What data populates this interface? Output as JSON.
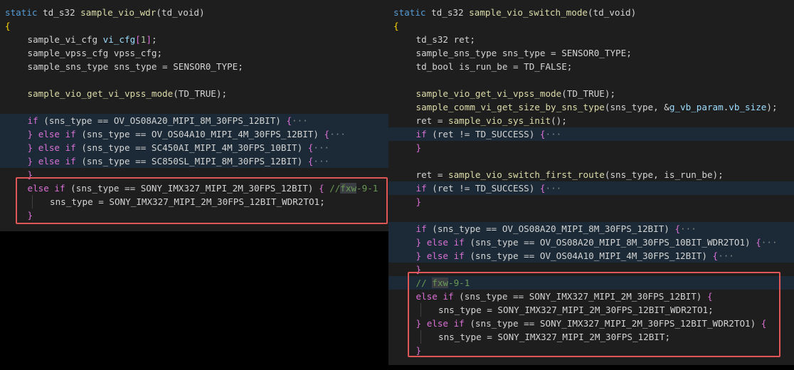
{
  "left": {
    "header": [
      {
        "tokens": [
          [
            "k",
            "static"
          ],
          [
            "t",
            " td_s32 "
          ],
          [
            "f",
            "sample_vio_wdr"
          ],
          [
            "t",
            "(td_void)"
          ]
        ]
      },
      {
        "tokens": [
          [
            "p",
            "{"
          ]
        ]
      }
    ],
    "lines": [
      {
        "indent": 1,
        "hl": false,
        "tokens": [
          [
            "t",
            "sample_vi_cfg "
          ],
          [
            "v",
            "vi_cfg"
          ],
          [
            "m",
            "["
          ],
          [
            "n",
            "1"
          ],
          [
            "m",
            "]"
          ],
          [
            "t",
            ";"
          ]
        ]
      },
      {
        "indent": 1,
        "hl": false,
        "tokens": [
          [
            "t",
            "sample_vpss_cfg vpss_cfg;"
          ]
        ]
      },
      {
        "indent": 1,
        "hl": false,
        "tokens": [
          [
            "t",
            "sample_sns_type sns_type = SENSOR0_TYPE;"
          ]
        ]
      },
      {
        "indent": 0,
        "hl": false,
        "tokens": []
      },
      {
        "indent": 1,
        "hl": false,
        "tokens": [
          [
            "f",
            "sample_vio_get_vi_vpss_mode"
          ],
          [
            "t",
            "(TD_TRUE);"
          ]
        ]
      },
      {
        "indent": 0,
        "hl": false,
        "tokens": []
      },
      {
        "indent": 1,
        "hl": true,
        "tokens": [
          [
            "m",
            "if"
          ],
          [
            "t",
            " (sns_type == OV_OS08A20_MIPI_8M_30FPS_12BIT) "
          ],
          [
            "m",
            "{"
          ],
          [
            "fold",
            "···"
          ]
        ]
      },
      {
        "indent": 1,
        "hl": true,
        "tokens": [
          [
            "m",
            "}"
          ],
          [
            "t",
            " "
          ],
          [
            "m",
            "else if"
          ],
          [
            "t",
            " (sns_type == OV_OS04A10_MIPI_4M_30FPS_12BIT) "
          ],
          [
            "m",
            "{"
          ],
          [
            "fold",
            "···"
          ]
        ]
      },
      {
        "indent": 1,
        "hl": true,
        "tokens": [
          [
            "m",
            "}"
          ],
          [
            "t",
            " "
          ],
          [
            "m",
            "else if"
          ],
          [
            "t",
            " (sns_type == SC450AI_MIPI_4M_30FPS_10BIT) "
          ],
          [
            "m",
            "{"
          ],
          [
            "fold",
            "···"
          ]
        ]
      },
      {
        "indent": 1,
        "hl": true,
        "tokens": [
          [
            "m",
            "}"
          ],
          [
            "t",
            " "
          ],
          [
            "m",
            "else if"
          ],
          [
            "t",
            " (sns_type == SC850SL_MIPI_8M_30FPS_12BIT) "
          ],
          [
            "m",
            "{"
          ],
          [
            "fold",
            "···"
          ]
        ]
      },
      {
        "indent": 1,
        "hl": false,
        "tokens": [
          [
            "m",
            "}"
          ]
        ]
      },
      {
        "indent": 1,
        "hl": false,
        "tokens": [
          [
            "m",
            "else if"
          ],
          [
            "t",
            " (sns_type == SONY_IMX327_MIPI_2M_30FPS_12BIT) "
          ],
          [
            "m",
            "{"
          ],
          [
            "t",
            " "
          ],
          [
            "c",
            "//"
          ],
          [
            "chl",
            "fxw"
          ],
          [
            "c",
            "-9-1"
          ]
        ]
      },
      {
        "indent": 2,
        "hl": false,
        "tokens": [
          [
            "t",
            "sns_type = SONY_IMX327_MIPI_2M_30FPS_12BIT_WDR2TO1;"
          ]
        ]
      },
      {
        "indent": 1,
        "hl": false,
        "tokens": [
          [
            "m",
            "}"
          ]
        ]
      }
    ]
  },
  "right": {
    "header": [
      {
        "tokens": [
          [
            "k",
            "static"
          ],
          [
            "t",
            " td_s32 "
          ],
          [
            "f",
            "sample_vio_switch_mode"
          ],
          [
            "t",
            "(td_void)"
          ]
        ]
      },
      {
        "tokens": [
          [
            "p",
            "{"
          ]
        ]
      }
    ],
    "lines": [
      {
        "indent": 1,
        "hl": false,
        "tokens": [
          [
            "t",
            "td_s32 ret;"
          ]
        ]
      },
      {
        "indent": 1,
        "hl": false,
        "tokens": [
          [
            "t",
            "sample_sns_type sns_type = SENSOR0_TYPE;"
          ]
        ]
      },
      {
        "indent": 1,
        "hl": false,
        "tokens": [
          [
            "t",
            "td_bool is_run_be = TD_FALSE;"
          ]
        ]
      },
      {
        "indent": 0,
        "hl": false,
        "tokens": []
      },
      {
        "indent": 1,
        "hl": false,
        "tokens": [
          [
            "f",
            "sample_vio_get_vi_vpss_mode"
          ],
          [
            "t",
            "(TD_TRUE);"
          ]
        ]
      },
      {
        "indent": 1,
        "hl": false,
        "tokens": [
          [
            "f",
            "sample_comm_vi_get_size_by_sns_type"
          ],
          [
            "t",
            "(sns_type, &"
          ],
          [
            "v",
            "g_vb_param"
          ],
          [
            "t",
            "."
          ],
          [
            "v",
            "vb_size"
          ],
          [
            "t",
            ");"
          ]
        ]
      },
      {
        "indent": 1,
        "hl": false,
        "tokens": [
          [
            "t",
            "ret = "
          ],
          [
            "f",
            "sample_vio_sys_init"
          ],
          [
            "t",
            "();"
          ]
        ]
      },
      {
        "indent": 1,
        "hl": true,
        "tokens": [
          [
            "m",
            "if"
          ],
          [
            "t",
            " (ret != TD_SUCCESS) "
          ],
          [
            "m",
            "{"
          ],
          [
            "fold",
            "···"
          ]
        ]
      },
      {
        "indent": 1,
        "hl": false,
        "tokens": [
          [
            "m",
            "}"
          ]
        ]
      },
      {
        "indent": 0,
        "hl": false,
        "tokens": []
      },
      {
        "indent": 1,
        "hl": false,
        "tokens": [
          [
            "t",
            "ret = "
          ],
          [
            "f",
            "sample_vio_switch_first_route"
          ],
          [
            "t",
            "(sns_type, is_run_be);"
          ]
        ]
      },
      {
        "indent": 1,
        "hl": true,
        "tokens": [
          [
            "m",
            "if"
          ],
          [
            "t",
            " (ret != TD_SUCCESS) "
          ],
          [
            "m",
            "{"
          ],
          [
            "fold",
            "···"
          ]
        ]
      },
      {
        "indent": 1,
        "hl": false,
        "tokens": [
          [
            "m",
            "}"
          ]
        ]
      },
      {
        "indent": 0,
        "hl": false,
        "tokens": []
      },
      {
        "indent": 1,
        "hl": true,
        "tokens": [
          [
            "m",
            "if"
          ],
          [
            "t",
            " (sns_type == OV_OS08A20_MIPI_8M_30FPS_12BIT) "
          ],
          [
            "m",
            "{"
          ],
          [
            "fold",
            "···"
          ]
        ]
      },
      {
        "indent": 1,
        "hl": true,
        "tokens": [
          [
            "m",
            "}"
          ],
          [
            "t",
            " "
          ],
          [
            "m",
            "else if"
          ],
          [
            "t",
            " (sns_type == OV_OS08A20_MIPI_8M_30FPS_10BIT_WDR2TO1) "
          ],
          [
            "m",
            "{"
          ],
          [
            "fold",
            "···"
          ]
        ]
      },
      {
        "indent": 1,
        "hl": true,
        "tokens": [
          [
            "m",
            "}"
          ],
          [
            "t",
            " "
          ],
          [
            "m",
            "else if"
          ],
          [
            "t",
            " (sns_type == OV_OS04A10_MIPI_4M_30FPS_12BIT) "
          ],
          [
            "m",
            "{"
          ],
          [
            "fold",
            "···"
          ]
        ]
      },
      {
        "indent": 1,
        "hl": false,
        "tokens": [
          [
            "m",
            "}"
          ]
        ]
      },
      {
        "indent": 1,
        "hl": true,
        "tokens": [
          [
            "c",
            "// "
          ],
          [
            "chl",
            "fxw"
          ],
          [
            "c",
            "-9-1"
          ]
        ]
      },
      {
        "indent": 1,
        "hl": false,
        "tokens": [
          [
            "m",
            "else if"
          ],
          [
            "t",
            " (sns_type == SONY_IMX327_MIPI_2M_30FPS_12BIT) "
          ],
          [
            "m",
            "{"
          ]
        ]
      },
      {
        "indent": 2,
        "hl": false,
        "tokens": [
          [
            "t",
            "sns_type = SONY_IMX327_MIPI_2M_30FPS_12BIT_WDR2TO1;"
          ]
        ]
      },
      {
        "indent": 1,
        "hl": false,
        "tokens": [
          [
            "m",
            "}"
          ],
          [
            "t",
            " "
          ],
          [
            "m",
            "else if"
          ],
          [
            "t",
            " (sns_type == SONY_IMX327_MIPI_2M_30FPS_12BIT_WDR2TO1) "
          ],
          [
            "m",
            "{"
          ]
        ]
      },
      {
        "indent": 2,
        "hl": false,
        "tokens": [
          [
            "t",
            "sns_type = SONY_IMX327_MIPI_2M_30FPS_12BIT;"
          ]
        ]
      },
      {
        "indent": 1,
        "hl": false,
        "tokens": [
          [
            "m",
            "}"
          ]
        ]
      }
    ]
  },
  "colors": {
    "highlight_box": "#e05555",
    "editor_bg": "#1e1e1e",
    "line_highlight": "#1b2a36"
  }
}
